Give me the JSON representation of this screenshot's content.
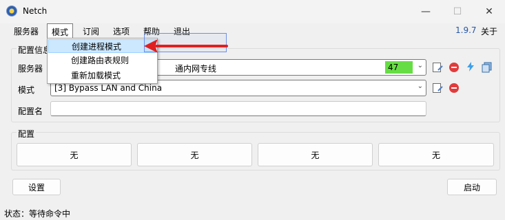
{
  "window": {
    "title": "Netch"
  },
  "menu": {
    "items": [
      "服务器",
      "模式",
      "订阅",
      "选项",
      "帮助",
      "退出"
    ],
    "version": "1.9.7",
    "about": "关于"
  },
  "mode_menu": {
    "items": [
      "创建进程模式",
      "创建路由表规则",
      "重新加载模式"
    ]
  },
  "config_info": {
    "group_label": "配置信息",
    "server_label": "服务器",
    "server_value": "通内网专线",
    "server_latency": "47",
    "mode_label": "模式",
    "mode_value": "[3] Bypass LAN and China",
    "profile_name_label": "配置名",
    "profile_name_value": ""
  },
  "profiles": {
    "group_label": "配置",
    "buttons": [
      "无",
      "无",
      "无",
      "无"
    ]
  },
  "actions": {
    "settings": "设置",
    "start": "启动"
  },
  "status": {
    "text": "状态：等待命令中"
  },
  "colors": {
    "accent": "#2456a6",
    "latency_bg": "#66dd44",
    "arrow_red": "#e02020",
    "highlight": "#cce8ff"
  },
  "icons": [
    "edit-icon",
    "remove-icon",
    "speed-test-icon",
    "copy-icon",
    "chevron-down-icon"
  ]
}
